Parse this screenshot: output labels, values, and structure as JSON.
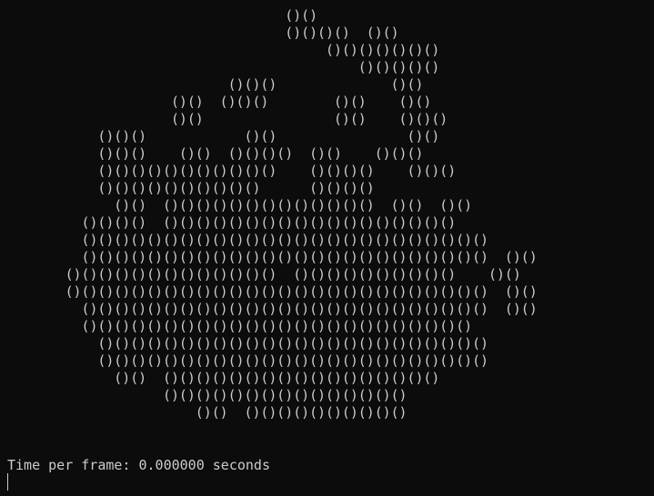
{
  "frame_lines": [
    "                                   ()()                                            |",
    "                                   ()()()()  ()()                                  |",
    "                                        ()()()()()()()                             |",
    "                                            ()()()()()                             |",
    "                            ()()()              ()()                               |",
    "                     ()()  ()()()        ()()    ()()                              |",
    "                     ()()                ()()    ()()()                            |",
    "            ()()()            ()()                ()()                             |",
    "            ()()()    ()()  ()()()()  ()()    ()()()                               |",
    "            ()()()()()()()()()()()    ()()()()    ()()()                           |",
    "            ()()()()()()()()()()      ()()()()                                     |",
    "              ()()  ()()()()()()()()()()()()()  ()()  ()()                         |",
    "          ()()()()  ()()()()()()()()()()()()()()()()()()                           |",
    "          ()()()()()()()()()()()()()()()()()()()()()()()()()                       |",
    "          ()()()()()()()()()()()()()()()()()()()()()()()()()  ()()                 |",
    "        ()()()()()()()()()()()()()  ()()()()()()()()()()    ()()                   |",
    "        ()()()()()()()()()()()()()()()()()()()()()()()()()()  ()()                 |",
    "          ()()()()()()()()()()()()()()()()()()()()()()()()()  ()()                 |",
    "          ()()()()()()()()()()()()()()()()()()()()()()()()                         |",
    "            ()()()()()()()()()()()()()()()()()()()()()()()()                       |",
    "            ()()()()()()()()()()()()()()()()()()()()()()()()                       |",
    "              ()()  ()()()()()()()()()()()()()()()()()                             |",
    "                    ()()()()()()()()()()()()()()()                                 |",
    "                        ()()  ()()()()()()()()()()                                 |",
    "                                                                                   |",
    "                                                                                   |"
  ],
  "status": {
    "text": "Time per frame: 0.000000 seconds"
  }
}
